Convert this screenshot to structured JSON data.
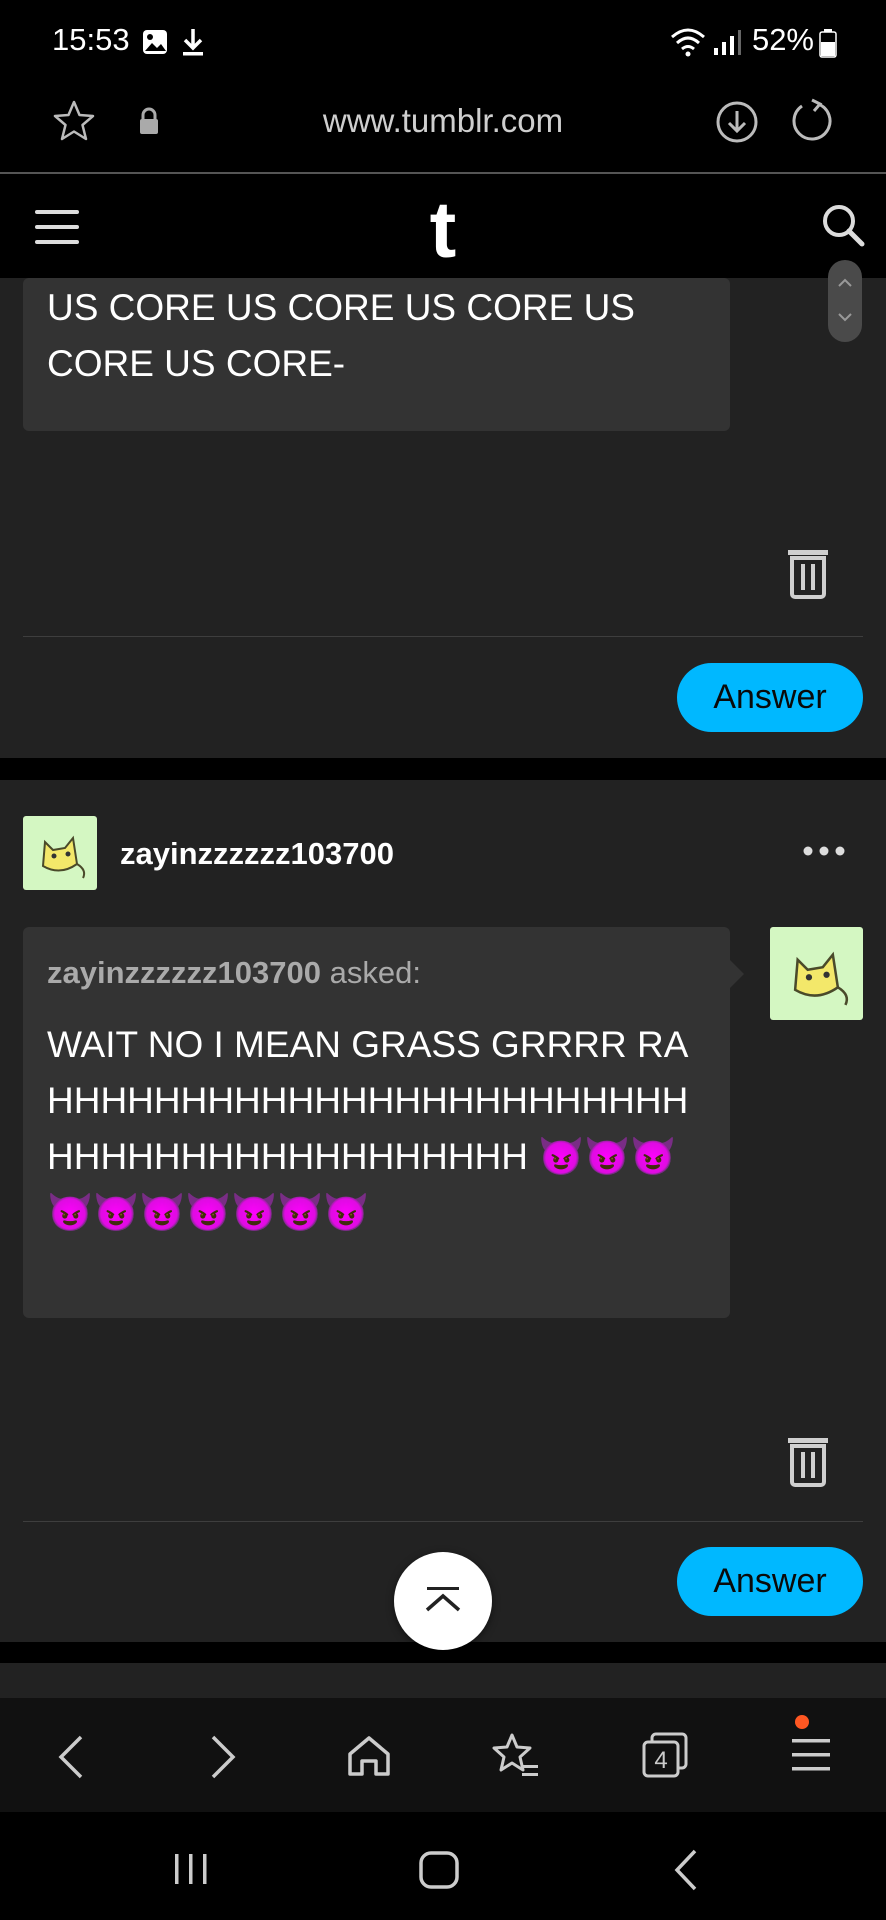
{
  "status_bar": {
    "time": "15:53",
    "battery": "52%",
    "icons": [
      "gallery-icon",
      "download-icon",
      "wifi-icon",
      "signal-icon",
      "battery-icon"
    ]
  },
  "browser": {
    "url": "www.tumblr.com",
    "icons": [
      "star-icon",
      "lock-icon",
      "download-page-icon",
      "reload-icon"
    ]
  },
  "tumblr": {
    "logo": "t",
    "icons": [
      "hamburger-menu-icon",
      "search-icon"
    ]
  },
  "posts": [
    {
      "question_text": "US CORE US CORE US CORE US CORE US CORE-",
      "answer_label": "Answer"
    },
    {
      "username": "zayinzzzzzz103700",
      "asker": "zayinzzzzzz103700",
      "asked_label": "asked:",
      "question_text": "WAIT NO I MEAN GRASS GRRRR RAHHHHHHHHHHHHHHHHHHHHHHHHHHHHHHHHHHHHHHHHHH 😈😈😈😈😈😈😈😈😈😈",
      "answer_label": "Answer"
    }
  ],
  "toolbar": {
    "tabs_count": "4",
    "icons": [
      "back-icon",
      "forward-icon",
      "home-icon",
      "bookmarks-icon",
      "tabs-icon",
      "menu-icon"
    ]
  },
  "colors": {
    "accent": "#00b8ff",
    "card": "#222222",
    "bubble": "#333333",
    "avatar": "#d4f7c2",
    "notification_dot": "#ff5722"
  }
}
